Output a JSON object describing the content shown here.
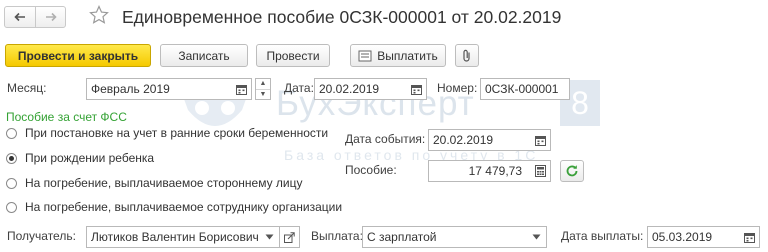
{
  "header": {
    "title": "Единовременное пособие 0СЗК-000001 от 20.02.2019"
  },
  "toolbar": {
    "post_close": "Провести и закрыть",
    "save": "Записать",
    "post": "Провести",
    "pay": "Выплатить"
  },
  "fields": {
    "month_label": "Месяц:",
    "month_value": "Февраль 2019",
    "date_label": "Дата:",
    "date_value": "20.02.2019",
    "number_label": "Номер:",
    "number_value": "0СЗК-000001",
    "event_date_label": "Дата события:",
    "event_date_value": "20.02.2019",
    "benefit_label": "Пособие:",
    "benefit_value": "17 479,73",
    "recipient_label": "Получатель:",
    "recipient_value": "Лютиков Валентин Борисович",
    "payment_label": "Выплата:",
    "payment_value": "С зарплатой",
    "payment_date_label": "Дата выплаты:",
    "payment_date_value": "05.03.2019"
  },
  "section": {
    "title": "Пособие за счет ФСС"
  },
  "radios": [
    {
      "label": "При постановке на учет в ранние сроки беременности",
      "selected": false
    },
    {
      "label": "При рождении ребенка",
      "selected": true
    },
    {
      "label": "На погребение, выплачиваемое стороннему лицу",
      "selected": false
    },
    {
      "label": "На погребение, выплачиваемое сотруднику организации",
      "selected": false
    }
  ],
  "watermark": {
    "brand": "БухЭксперт",
    "badge": "8",
    "tagline": "База ответов по учету в 1С"
  },
  "icons": {
    "back": "arrow-left-icon",
    "forward": "arrow-right-icon",
    "favorite": "star-icon",
    "attach": "paperclip-icon",
    "calendar": "calendar-icon",
    "calculator": "calculator-icon",
    "refresh": "refresh-icon",
    "open": "open-link-icon"
  },
  "colors": {
    "primary_button": "#f5c900",
    "section_title": "#34a234",
    "refresh_icon": "#3aa03a",
    "watermark": "#dce4ec"
  }
}
